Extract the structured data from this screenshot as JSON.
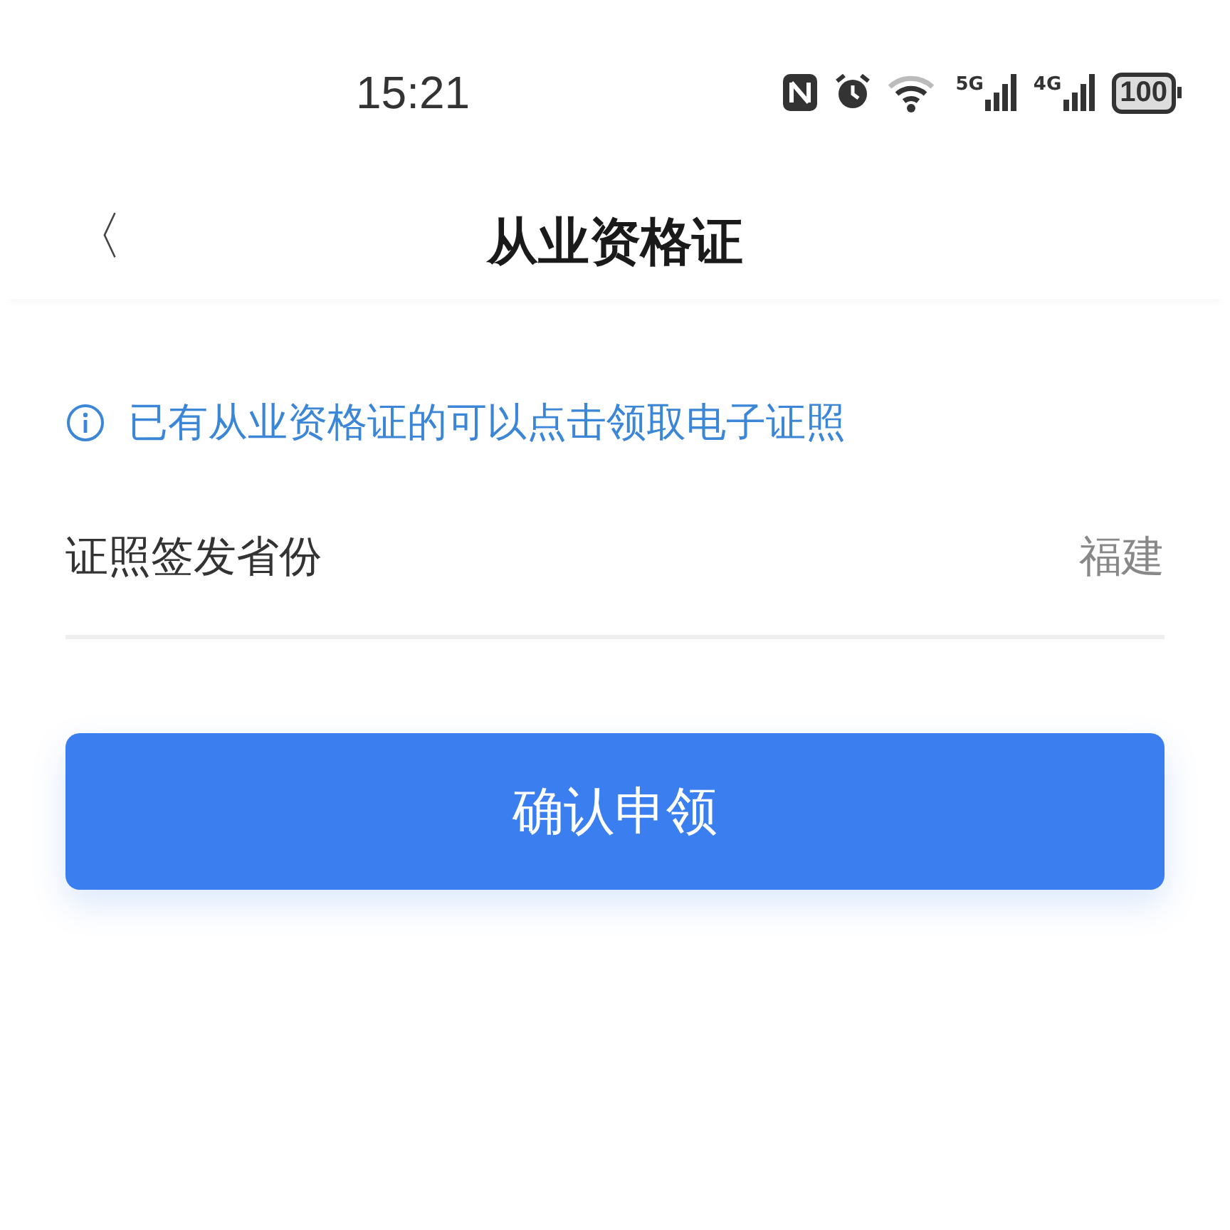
{
  "status_bar": {
    "time": "15:21",
    "network_1": "5G",
    "network_2": "4G",
    "battery": "100"
  },
  "header": {
    "back": "〈",
    "title": "从业资格证"
  },
  "notice": "已有从业资格证的可以点击领取电子证照",
  "field": {
    "label": "证照签发省份",
    "value": "福建"
  },
  "button": "确认申领"
}
